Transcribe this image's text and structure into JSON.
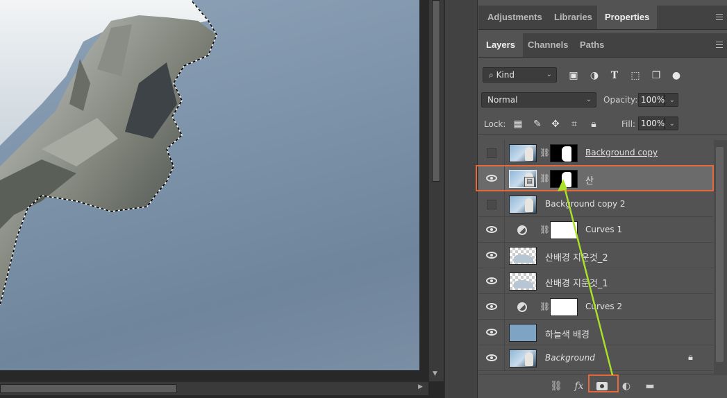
{
  "panels_top": {
    "tabs": [
      "Adjustments",
      "Libraries",
      "Properties"
    ],
    "active_tab": "Properties"
  },
  "panels_layers": {
    "tabs": [
      "Layers",
      "Channels",
      "Paths"
    ],
    "active_tab": "Layers"
  },
  "filter": {
    "kind_label": "Kind",
    "icons": [
      "pixel-filter-icon",
      "adjustment-filter-icon",
      "type-filter-icon",
      "shape-filter-icon",
      "smart-object-filter-icon",
      "filter-toggle-icon"
    ]
  },
  "blend": {
    "mode": "Normal",
    "opacity_label": "Opacity:",
    "opacity": "100%"
  },
  "lock": {
    "label": "Lock:",
    "fill_label": "Fill:",
    "fill": "100%",
    "icons": [
      "lock-transparent-icon",
      "lock-image-icon",
      "lock-position-icon",
      "lock-artboard-icon",
      "lock-all-icon"
    ]
  },
  "layers": [
    {
      "name": "Background copy",
      "visible": false,
      "type": "photo-mask",
      "style": "underline"
    },
    {
      "name": "산",
      "visible": true,
      "type": "smart-mask",
      "selected": true
    },
    {
      "name": "Background copy 2",
      "visible": false,
      "type": "photo"
    },
    {
      "name": "Curves 1",
      "visible": true,
      "type": "adjustment"
    },
    {
      "name": "산배경 지운것_2",
      "visible": true,
      "type": "transparent"
    },
    {
      "name": "산배경 지운것_1",
      "visible": true,
      "type": "transparent"
    },
    {
      "name": "Curves 2",
      "visible": true,
      "type": "adjustment"
    },
    {
      "name": "하늘색 배경",
      "visible": true,
      "type": "sky"
    },
    {
      "name": "Background",
      "visible": true,
      "type": "photo",
      "style": "italic",
      "locked": true
    }
  ],
  "toolbar": {
    "icons": [
      "link-layers-icon",
      "fx-icon",
      "add-mask-icon",
      "adjustment-layer-icon",
      "new-group-icon"
    ],
    "fx_label": "fx"
  },
  "colors": {
    "highlight": "#e8683a",
    "arrow": "#a8e02a",
    "panel_bg": "#535353",
    "tab_bg": "#424242"
  }
}
